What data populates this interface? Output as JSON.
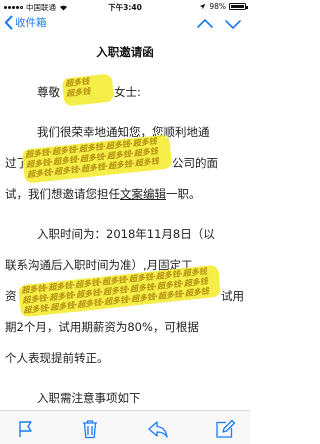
{
  "status_bar": {
    "carrier": "中国联通",
    "time": "下午3:40",
    "battery_percent": "98%",
    "battery_level": 0.98,
    "icons": [
      "signal-dots-icon",
      "wifi-icon",
      "location-icon",
      "battery-icon"
    ]
  },
  "nav": {
    "back_label": "收件箱",
    "icons": [
      "chevron-left-icon",
      "chevron-up-icon",
      "chevron-down-icon"
    ]
  },
  "letter": {
    "title": "入职邀请函",
    "greeting_prefix": "尊敬",
    "greeting_suffix": "女士:",
    "para1_line1": "我们很荣幸地通知您，您顺利地通",
    "para1_line2_prefix": "过了",
    "para1_line2_suffix": "公司的面",
    "para1_line3_prefix": "试，我们想邀请您担任",
    "para1_line3_position": "文案编辑",
    "para1_line3_suffix": "一职。",
    "para2_line1": "入职时间为：2018年11月8日（以",
    "para2_line2": "联系沟通后入职时间为准）,月固定工",
    "para2_line3_prefix": "资",
    "para2_line3_suffix": "试用",
    "para2_line4": "期2个月，试用期薪资为80%，可根据",
    "para2_line5": "个人表现提前转正。",
    "para3_line1": "入职需注意事项如下"
  },
  "watermark": {
    "text": "超多钱",
    "color": "#f6ed3b"
  },
  "toolbar": {
    "icons": [
      "flag-icon",
      "trash-icon",
      "reply-icon",
      "compose-icon"
    ]
  },
  "colors": {
    "accent": "#1a7cf4",
    "text": "#222222"
  }
}
